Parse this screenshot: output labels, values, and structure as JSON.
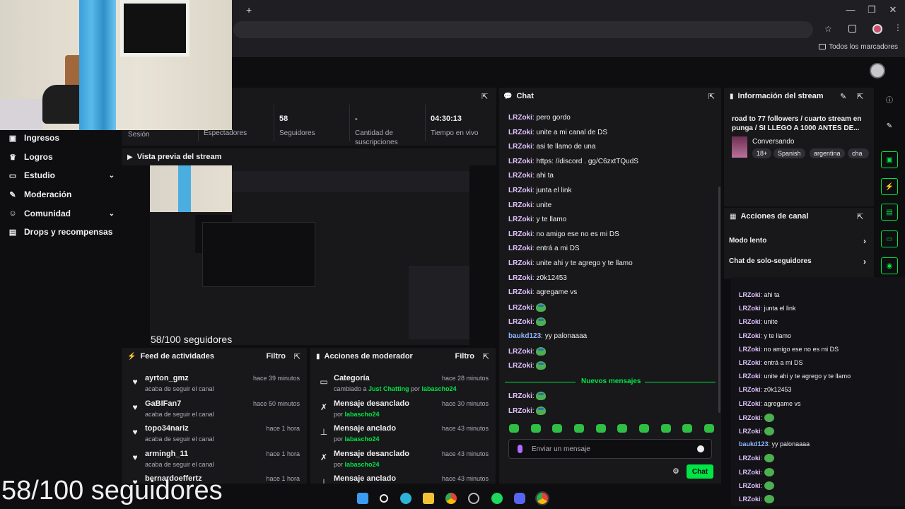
{
  "browser": {
    "new_tab_label": "+",
    "bookmarks_label": "Todos los marcadores",
    "window_controls": [
      "—",
      "❐",
      "✕"
    ]
  },
  "overlay_caption": "58/100 seguidores",
  "sidebar": {
    "items": [
      {
        "label": "Ingresos",
        "icon": "revenue-icon",
        "has_chevron": false
      },
      {
        "label": "Logros",
        "icon": "trophy-icon",
        "has_chevron": false
      },
      {
        "label": "Estudio",
        "icon": "studio-icon",
        "has_chevron": true
      },
      {
        "label": "Moderación",
        "icon": "wrench-icon",
        "has_chevron": false
      },
      {
        "label": "Comunidad",
        "icon": "community-icon",
        "has_chevron": true
      },
      {
        "label": "Drops y recompensas",
        "icon": "gift-icon",
        "has_chevron": false
      }
    ]
  },
  "stats": {
    "items": [
      {
        "value": "",
        "label": "Sesión"
      },
      {
        "value": "",
        "label": "Espectadores"
      },
      {
        "value": "58",
        "label": "Seguidores"
      },
      {
        "value": "-",
        "label": "Cantidad de suscripciones"
      },
      {
        "value": "04:30:13",
        "label": "Tiempo en vivo"
      }
    ]
  },
  "preview": {
    "title": "Vista previa del stream",
    "caption": "58/100 seguidores"
  },
  "activity_feed": {
    "title": "Feed de actividades",
    "filter_label": "Filtro",
    "items": [
      {
        "name": "ayrton_gmz",
        "desc": "acaba de seguir el canal",
        "time": "hace 39 minutos"
      },
      {
        "name": "GaBIFan7",
        "desc": "acaba de seguir el canal",
        "time": "hace 50 minutos"
      },
      {
        "name": "topo34nariz",
        "desc": "acaba de seguir el canal",
        "time": "hace 1 hora"
      },
      {
        "name": "armingh_11",
        "desc": "acaba de seguir el canal",
        "time": "hace 1 hora"
      },
      {
        "name": "bernardoeffertz",
        "desc": "",
        "time": "hace 1 hora"
      }
    ]
  },
  "mod_actions": {
    "title": "Acciones de moderador",
    "filter_label": "Filtro",
    "items": [
      {
        "title": "Categoría",
        "pre": "cambiado a ",
        "highlight": "Just Chatting",
        "mid": " por ",
        "user": "labascho24",
        "time": "hace 28 minutos",
        "icon": "category-icon"
      },
      {
        "title": "Mensaje desanclado",
        "pre": "",
        "highlight": "",
        "mid": "por ",
        "user": "labascho24",
        "time": "hace 30 minutos",
        "icon": "unpin-icon"
      },
      {
        "title": "Mensaje anclado",
        "pre": "",
        "highlight": "",
        "mid": "por ",
        "user": "labascho24",
        "time": "hace 43 minutos",
        "icon": "pin-icon"
      },
      {
        "title": "Mensaje desanclado",
        "pre": "",
        "highlight": "",
        "mid": "por ",
        "user": "labascho24",
        "time": "hace 43 minutos",
        "icon": "unpin-icon"
      },
      {
        "title": "Mensaje anclado",
        "pre": "",
        "highlight": "",
        "mid": "",
        "user": "",
        "time": "hace 43 minutos",
        "icon": "pin-icon"
      }
    ]
  },
  "chat": {
    "title": "Chat",
    "messages_before": [
      {
        "user": "LRZoki",
        "text": "pero gordo"
      },
      {
        "user": "LRZoki",
        "text": "unite a mi canal de DS"
      },
      {
        "user": "LRZoki",
        "text": "asi te llamo de una"
      },
      {
        "user": "LRZoki",
        "text": "https: //discord . gg/C6zxtTQudS"
      },
      {
        "user": "LRZoki",
        "text": "ahi ta"
      },
      {
        "user": "LRZoki",
        "text": "junta el link"
      },
      {
        "user": "LRZoki",
        "text": "unite"
      },
      {
        "user": "LRZoki",
        "text": "y te llamo"
      },
      {
        "user": "LRZoki",
        "text": "no amigo ese no es mi DS"
      },
      {
        "user": "LRZoki",
        "text": "entrá a mi DS"
      },
      {
        "user": "LRZoki",
        "text": "unite ahi y te agrego y te llamo"
      },
      {
        "user": "LRZoki",
        "text": "z0k12453"
      },
      {
        "user": "LRZoki",
        "text": "agregame vs"
      },
      {
        "user": "LRZoki",
        "text": "",
        "emote": true
      },
      {
        "user": "LRZoki",
        "text": "",
        "emote": true
      },
      {
        "user": "baukd123",
        "text": "yy palonaaaa",
        "alt": true
      },
      {
        "user": "LRZoki",
        "text": "",
        "emote": true
      },
      {
        "user": "LRZoki",
        "text": "",
        "emote": true
      }
    ],
    "new_messages_label": "Nuevos mensajes",
    "messages_after": [
      {
        "user": "LRZoki",
        "text": "",
        "emote": true
      },
      {
        "user": "LRZoki",
        "text": "",
        "emote": true
      }
    ],
    "input_placeholder": "Enviar un mensaje",
    "send_label": "Chat"
  },
  "stream_info": {
    "title": "Información del stream",
    "stream_title": "road to 77 followers / cuarto stream en punga / SI LLEGO A 1000 ANTES DE...",
    "category": "Conversando",
    "tags": [
      "18+",
      "Spanish",
      "argentina",
      "cha"
    ]
  },
  "channel_actions": {
    "title": "Acciones de canal",
    "items": [
      {
        "label": "Modo lento"
      },
      {
        "label": "Chat de solo-seguidores"
      }
    ]
  },
  "overlay_chat": [
    {
      "user": "LRZoki",
      "text": "ahi ta"
    },
    {
      "user": "LRZoki",
      "text": "junta el link"
    },
    {
      "user": "LRZoki",
      "text": "unite"
    },
    {
      "user": "LRZoki",
      "text": "y te llamo"
    },
    {
      "user": "LRZoki",
      "text": "no amigo ese no es mi DS"
    },
    {
      "user": "LRZoki",
      "text": "entrá a mi DS"
    },
    {
      "user": "LRZoki",
      "text": "unite ahi y te agrego y te llamo"
    },
    {
      "user": "LRZoki",
      "text": "z0k12453"
    },
    {
      "user": "LRZoki",
      "text": "agregame vs"
    },
    {
      "user": "LRZoki",
      "text": "",
      "emote": true
    },
    {
      "user": "LRZoki",
      "text": "",
      "emote": true
    },
    {
      "user": "baukd123",
      "text": "yy palonaaaa",
      "alt": true
    },
    {
      "user": "LRZoki",
      "text": "",
      "emote": true
    },
    {
      "user": "LRZoki",
      "text": "",
      "emote": true
    },
    {
      "user": "LRZoki",
      "text": "",
      "emote": true
    },
    {
      "user": "LRZoki",
      "text": "",
      "emote": true
    }
  ],
  "colors": {
    "accent": "#00e545",
    "bg": "#0e0e10",
    "panel": "#18181b",
    "username": "#e1c2ff"
  }
}
